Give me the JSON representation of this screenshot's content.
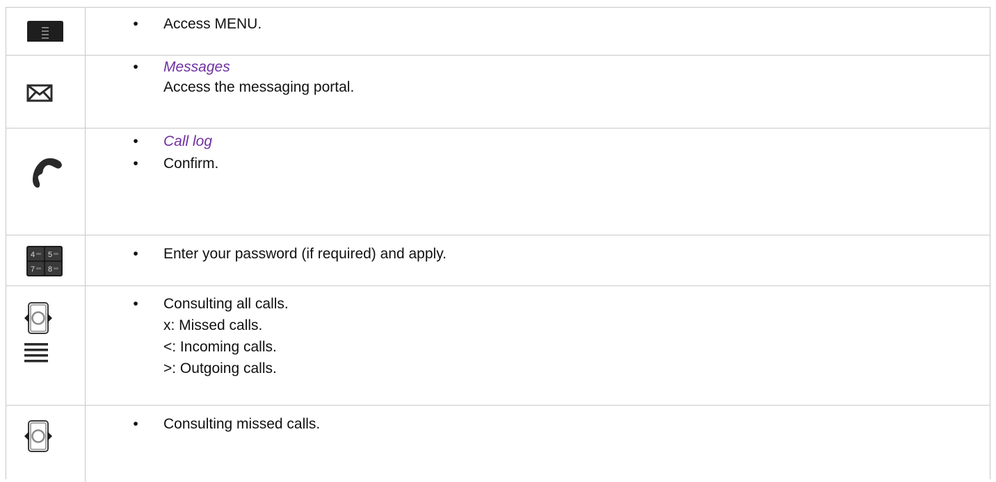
{
  "rows": [
    {
      "icon": "menu-key-icon",
      "lines": [
        {
          "bullet": "•",
          "text": "Access MENU."
        }
      ]
    },
    {
      "icon": "envelope-icon",
      "lines": [
        {
          "bullet": "•",
          "text": "Messages"
        },
        {
          "text": "Access the messaging portal."
        }
      ]
    },
    {
      "icon": "handset-icon",
      "lines": [
        {
          "bullet": "•",
          "text": "Call log"
        },
        {
          "bullet": "•",
          "text": "Confirm."
        }
      ]
    },
    {
      "icon": "keypad-icon",
      "keys": [
        "4",
        "5",
        "7",
        "8"
      ],
      "lines": [
        {
          "bullet": "•",
          "text": "Enter your password (if required) and apply."
        }
      ]
    },
    {
      "icon": "navigator-left-right-icon",
      "icon2": "list-lines-icon",
      "lines": [
        {
          "bullet": "•",
          "text": "Consulting all calls."
        },
        {
          "text": "x: Missed calls."
        },
        {
          "text": "<: Incoming calls."
        },
        {
          "text": ">: Outgoing calls."
        }
      ]
    },
    {
      "icon": "navigator-left-right-icon",
      "lines": [
        {
          "bullet": "•",
          "text": "Consulting missed calls."
        }
      ]
    }
  ],
  "colors": {
    "text": "#111111",
    "accent_italic": "#7030a0",
    "border": "#c8c8c8"
  }
}
